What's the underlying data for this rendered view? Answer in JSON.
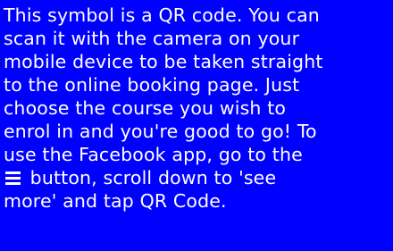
{
  "colors": {
    "background": "#0000ff",
    "text": "#ffffff"
  },
  "message": {
    "lines": [
      "This symbol is a QR code. You can",
      "scan it with the camera on your",
      "mobile device to be taken straight",
      "to the online booking page. Just",
      "choose the course you wish to",
      "enrol in and you're good to go! To",
      "use the Facebook app, go to the",
      " button, scroll down to 'see",
      "more' and tap QR Code."
    ],
    "menu_icon": "hamburger-menu-icon"
  }
}
